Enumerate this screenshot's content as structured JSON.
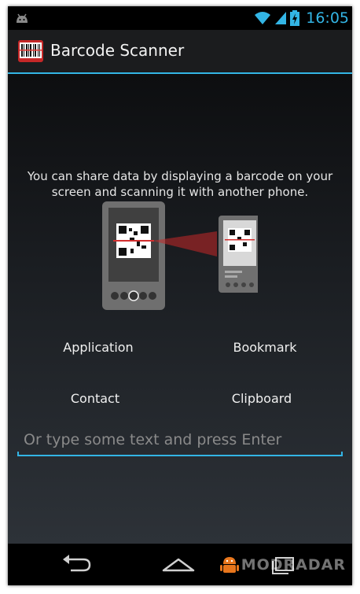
{
  "status_bar": {
    "time": "16:05",
    "icons": [
      "android-notification-icon",
      "wifi-icon",
      "signal-icon",
      "battery-charging-icon"
    ]
  },
  "action_bar": {
    "title": "Barcode Scanner",
    "icon": "barcode-app-icon"
  },
  "main": {
    "intro_text": "You can share data by displaying a barcode on your screen and scanning it with another phone.",
    "options": [
      {
        "label": "Application"
      },
      {
        "label": "Bookmark"
      },
      {
        "label": "Contact"
      },
      {
        "label": "Clipboard"
      }
    ],
    "text_input": {
      "placeholder": "Or type some text and press Enter",
      "value": ""
    }
  },
  "nav_bar": {
    "buttons": [
      "back-icon",
      "home-icon",
      "recents-icon"
    ],
    "watermark": "MODRADAR"
  },
  "colors": {
    "accent": "#33b5e5",
    "status_background": "#000000",
    "action_bar_background": "#1b1c1e"
  }
}
